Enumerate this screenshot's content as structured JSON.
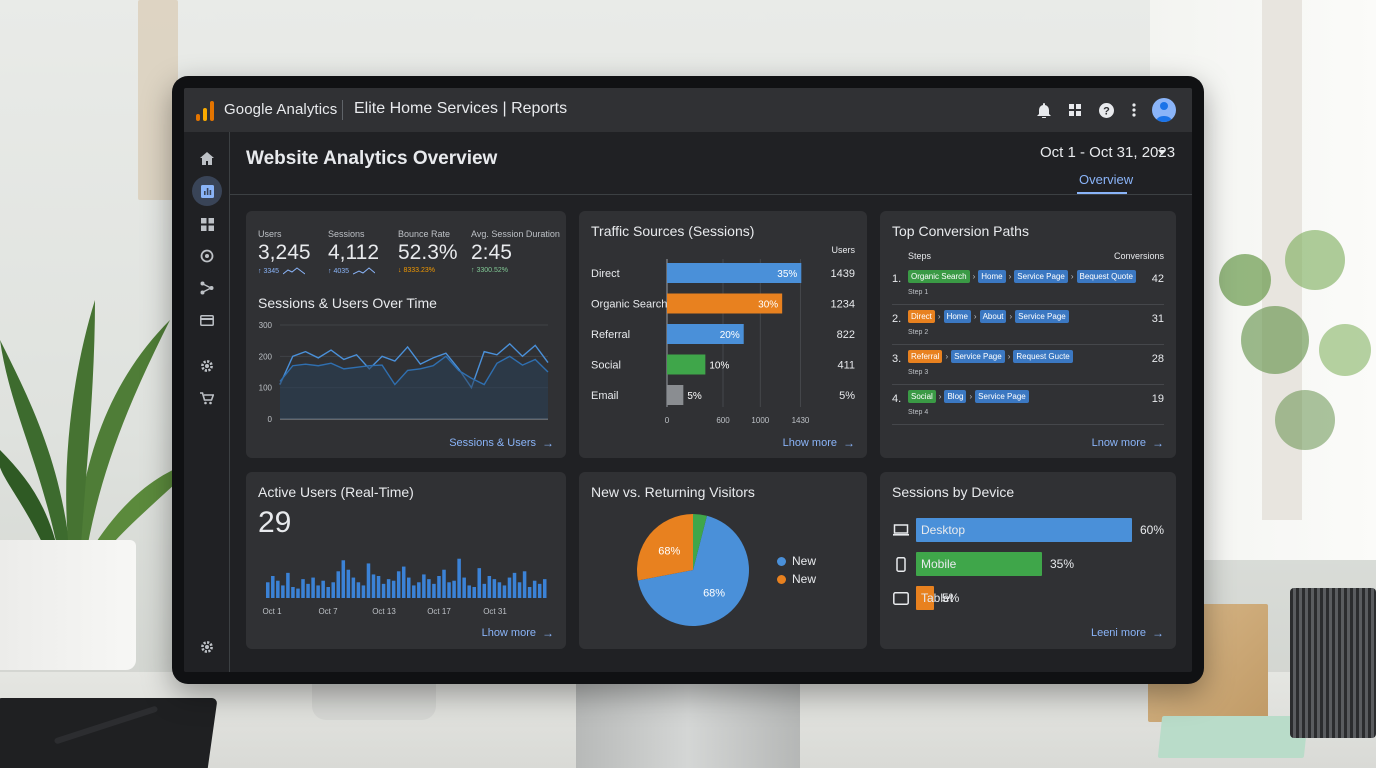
{
  "topbar": {
    "brand": "Google Analytics",
    "property": "Elite Home Services | Reports",
    "icons": [
      "bell-icon",
      "apps-grid-icon",
      "help-icon",
      "more-vert-icon",
      "account-avatar"
    ]
  },
  "sidebar": {
    "items": [
      "home-icon",
      "reports-icon",
      "dashboards-icon",
      "explore-icon",
      "funnel-icon",
      "advertising-icon",
      "settings-icon",
      "cart-icon",
      "admin-gear-icon"
    ],
    "active": "reports-icon"
  },
  "header": {
    "title": "Website Analytics Overview",
    "date_range": "Oct 1 - Oct 31, 2023",
    "tab": "Overview"
  },
  "kpis": [
    {
      "label": "Users",
      "value": "3,245",
      "delta": "↑ 3345"
    },
    {
      "label": "Sessions",
      "value": "4,112",
      "delta": "↑ 4035"
    },
    {
      "label": "Bounce Rate",
      "value": "52.3%",
      "delta": "↓ 8333.23%"
    },
    {
      "label": "Avg. Session Duration",
      "value": "2:45",
      "delta": "↑ 3300.52%"
    }
  ],
  "colors": {
    "accent": "#8ab4f8",
    "blue": "#4a90d9",
    "orange": "#e8811f",
    "green": "#3fa64a",
    "gray": "#8a8d91",
    "positive": "#81c995",
    "negative": "#f29900"
  },
  "sessions_chart": {
    "title": "Sessions & Users Over Time",
    "link": "Sessions & Users",
    "chart_data": {
      "type": "line",
      "title": "Sessions & Users Over Time",
      "ylim": [
        0,
        300
      ],
      "yticks": [
        "300",
        "200",
        "100",
        "0"
      ],
      "series": [
        {
          "values": [
            110,
            200,
            215,
            195,
            220,
            190,
            205,
            160,
            200,
            185,
            230,
            175,
            195,
            210,
            160,
            100,
            215,
            205,
            240,
            200,
            235,
            180
          ]
        },
        {
          "values": [
            120,
            170,
            175,
            170,
            178,
            160,
            165,
            170,
            172,
            110,
            155,
            160,
            170,
            200,
            155,
            130,
            110,
            178,
            200,
            172,
            190,
            150
          ]
        }
      ]
    }
  },
  "traffic_sources": {
    "title": "Traffic Sources (Sessions)",
    "users_header": "Users",
    "link": "Lhow more",
    "chart_data": {
      "type": "bar",
      "title": "Traffic Sources (Sessions)",
      "categories": [
        "Direct",
        "Organic Search",
        "Referral",
        "Social",
        "Email"
      ],
      "values": [
        1439,
        1234,
        822,
        411,
        175
      ],
      "bar_labels": [
        "35%",
        "30%",
        "20%",
        "10%",
        "5%"
      ],
      "right_labels": [
        "1439",
        "1234",
        "822",
        "411",
        "5%"
      ],
      "xticks": [
        "0",
        "600",
        "1000",
        "1430"
      ],
      "xlim": [
        0,
        1500
      ]
    }
  },
  "conversion_paths": {
    "title": "Top Conversion Paths",
    "steps_header": "Steps",
    "conv_header": "Conversions",
    "link": "Lnow more",
    "rows": [
      {
        "num": "1.",
        "step": "Step 1",
        "conv": "42",
        "chips": [
          [
            "Organic Search",
            "green"
          ],
          [
            "Home",
            "blue"
          ],
          [
            "Service Page",
            "blue"
          ],
          [
            "Bequest Quote",
            "blue"
          ]
        ]
      },
      {
        "num": "2.",
        "step": "Step 2",
        "conv": "31",
        "chips": [
          [
            "Direct",
            "orange"
          ],
          [
            "Home",
            "blue"
          ],
          [
            "About",
            "blue"
          ],
          [
            "Service Page",
            "blue"
          ]
        ]
      },
      {
        "num": "3.",
        "step": "Step 3",
        "conv": "28",
        "chips": [
          [
            "Referral",
            "orange"
          ],
          [
            "Service Page",
            "blue"
          ],
          [
            "Request Gucte",
            "blue"
          ]
        ]
      },
      {
        "num": "4.",
        "step": "Step 4",
        "conv": "19",
        "chips": [
          [
            "Social",
            "green"
          ],
          [
            "Blog",
            "blue"
          ],
          [
            "Service Page",
            "blue"
          ]
        ]
      }
    ]
  },
  "active_users": {
    "title": "Active Users (Real-Time)",
    "value": "29",
    "link": "Lhow more",
    "chart_data": {
      "type": "bar",
      "title": "Active Users (Real-Time)",
      "categories": [
        "Oct 1",
        "Oct 7",
        "Oct 13",
        "Oct 17",
        "Oct 31"
      ],
      "values": [
        10,
        14,
        11,
        8,
        16,
        7,
        6,
        12,
        9,
        13,
        8,
        11,
        7,
        10,
        17,
        24,
        18,
        13,
        10,
        8,
        22,
        15,
        14,
        9,
        12,
        11,
        17,
        20,
        13,
        8,
        10,
        15,
        12,
        9,
        14,
        18,
        10,
        11,
        25,
        13,
        8,
        7,
        19,
        9,
        14,
        12,
        10,
        8,
        13,
        16,
        10,
        17,
        7,
        11,
        9,
        12
      ],
      "ylim": [
        0,
        28
      ]
    }
  },
  "new_returning": {
    "title": "New vs. Returning Visitors",
    "chart_data": {
      "type": "pie",
      "title": "New vs. Returning Visitors",
      "slices": [
        {
          "label": "68%",
          "value": 68,
          "color": "#4a90d9"
        },
        {
          "label": "68%",
          "value": 28,
          "color": "#e8811f"
        },
        {
          "label": "",
          "value": 4,
          "color": "#3fa64a"
        }
      ],
      "legend": [
        {
          "name": "New",
          "color": "#4a90d9"
        },
        {
          "name": "New",
          "color": "#e8811f"
        }
      ]
    }
  },
  "devices": {
    "title": "Sessions by Device",
    "link": "Leeni more",
    "chart_data": {
      "type": "bar",
      "title": "Sessions by Device",
      "categories": [
        "Desktop",
        "Mobile",
        "Tablet"
      ],
      "values": [
        60,
        35,
        5
      ],
      "labels": [
        "60%",
        "35%",
        "5%"
      ],
      "colors": [
        "#4a90d9",
        "#3fa64a",
        "#e8811f"
      ]
    }
  }
}
